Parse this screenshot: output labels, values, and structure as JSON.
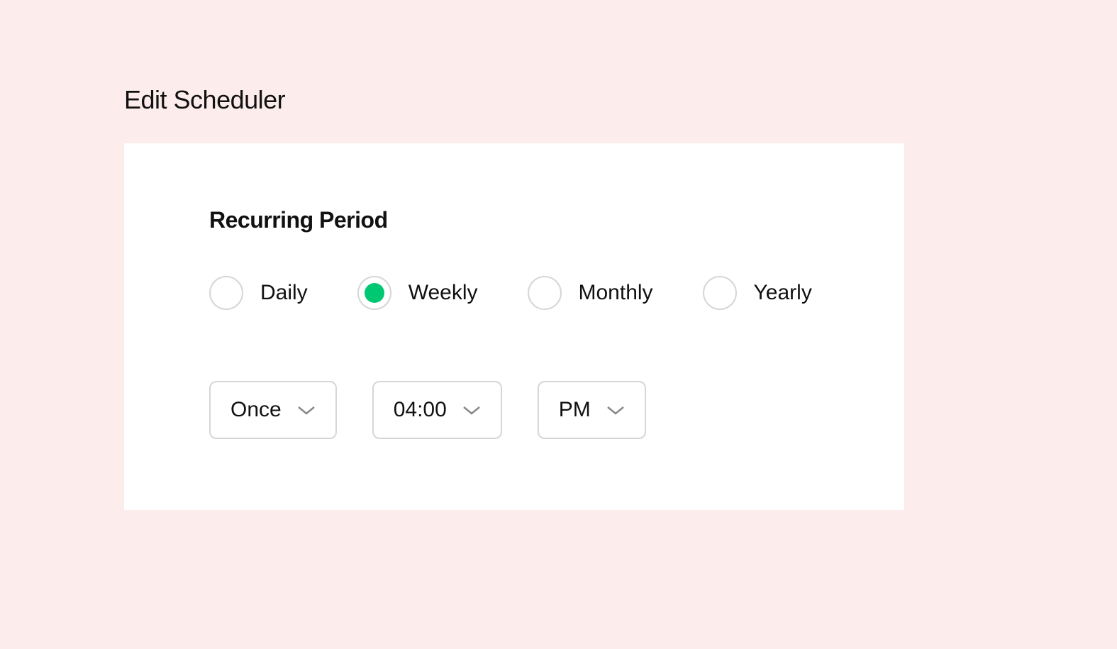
{
  "title": "Edit Scheduler",
  "section_heading": "Recurring Period",
  "period_options": [
    {
      "label": "Daily",
      "selected": false
    },
    {
      "label": "Weekly",
      "selected": true
    },
    {
      "label": "Monthly",
      "selected": false
    },
    {
      "label": "Yearly",
      "selected": false
    }
  ],
  "dropdowns": {
    "frequency": "Once",
    "time": "04:00",
    "meridiem": "PM"
  },
  "colors": {
    "background": "#fdecec",
    "panel": "#ffffff",
    "accent": "#00c771",
    "border": "#d6d6d6"
  }
}
